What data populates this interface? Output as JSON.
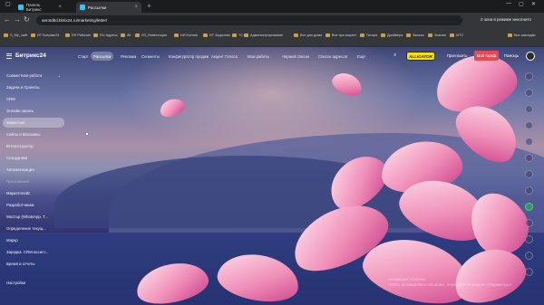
{
  "browser": {
    "tabs": [
      {
        "label": "Панель Битрикс",
        "active": false
      },
      {
        "label": "Рассылки",
        "active": true
      }
    ],
    "url": "aerotdbd.bitrix24.ru/marketing/letter/",
    "incognito_label": "2 окна в режиме инкогнито",
    "bookmarks": [
      "S_My_сайт",
      "ИТ Битрикс24",
      "RS Рабочие",
      "RU Адреса",
      "Alt",
      "ИЗ_Инвестиции",
      "ИИ Ксения",
      "ИТ Задачник",
      "ТС",
      "Администрирование",
      "Все для дома",
      "Все про маркет",
      "Гитара",
      "Драйвера",
      "Заказы",
      "Знания",
      "MTC",
      "Все закладки"
    ]
  },
  "app": {
    "logo": "Битрикс24",
    "nav": [
      "Старт",
      "Рассылки",
      "Реклама",
      "Сегменты",
      "Конфигуратор продаж",
      "Акцент Голоса",
      "Мои работы",
      "Черный список",
      "Список адресов",
      "Ещё"
    ],
    "active_nav": "Рассылки",
    "brand_badge": "ALLIGATOR",
    "invite": "Пригласить",
    "tariff": "Мой тариф",
    "help": "Помощь",
    "sidebar": [
      {
        "label": "Совместная работа",
        "arrow": "⌄"
      },
      {
        "label": "Задачи и Проекты"
      },
      {
        "label": "CRM"
      },
      {
        "label": "Онлайн-запись"
      },
      {
        "label": "Маркетинг",
        "active": true
      },
      {
        "label": "Сайты и Магазины"
      },
      {
        "label": "BI Конструктор"
      },
      {
        "label": "Сотрудники"
      },
      {
        "label": "Автоматизация"
      },
      {
        "label": "Приложения",
        "dim": true
      },
      {
        "label": "Маркетплейс"
      },
      {
        "label": "Разработчикам"
      },
      {
        "label": "Wazzup (WhatsApp, T..."
      },
      {
        "label": "Определение текущ..."
      },
      {
        "label": "Маркр"
      },
      {
        "label": "Зарядка. CRM-ассист..."
      },
      {
        "label": "Время и отчеты"
      }
    ],
    "settings": "Настройки",
    "watermark_line1": "Активация Windows",
    "watermark_line2": "Чтобы активировать Windows, перейдите в раздел «Параметры»."
  }
}
